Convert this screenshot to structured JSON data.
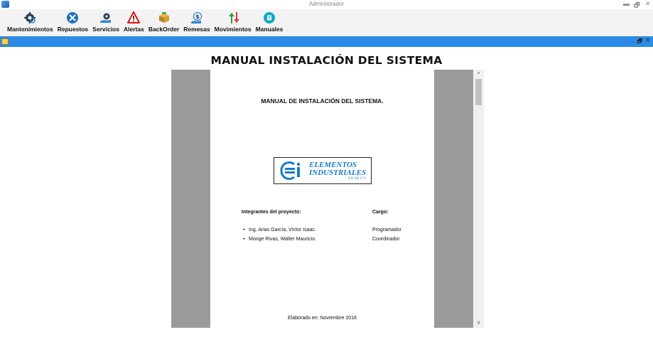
{
  "window": {
    "title": "Administrador",
    "controls": [
      "▬",
      "🗗",
      "✕"
    ]
  },
  "toolbar": {
    "items": [
      {
        "label": "Mantenimientos",
        "icon": "gear-search-icon"
      },
      {
        "label": "Repuestos",
        "icon": "wrench-icon"
      },
      {
        "label": "Servicios",
        "icon": "hand-gear-icon"
      },
      {
        "label": "Alertas",
        "icon": "warning-icon"
      },
      {
        "label": "BackOrder",
        "icon": "box-icon"
      },
      {
        "label": "Remesas",
        "icon": "money-hand-icon"
      },
      {
        "label": "Movimientos",
        "icon": "up-down-arrows-icon"
      },
      {
        "label": "Manuales",
        "icon": "book-icon"
      }
    ]
  },
  "child_window": {
    "controls": [
      "_",
      "🗗",
      "✕"
    ]
  },
  "main": {
    "heading": "MANUAL INSTALACIÓN DEL SISTEMA"
  },
  "document": {
    "title": "MANUAL DE INSTALACIÓN DEL SISTEMA.",
    "logo": {
      "line1": "ELEMENTOS",
      "line2": "INDUSTRIALES",
      "line3": "S.A. DE C.V."
    },
    "members_header": "Integrantes del proyecto:",
    "role_header": "Cargo:",
    "members": [
      {
        "name": "Ing. Arias García, Víctor Isaac.",
        "role": "Programador"
      },
      {
        "name": "Monge Rivas, Walter Mauricio.",
        "role": "Coordinador"
      }
    ],
    "footer": "Elaborado en: Noviembre 2018"
  },
  "scrollbar": {
    "up": "^",
    "down": "v"
  },
  "colors": {
    "mdi_bar": "#2b8be6",
    "viewer_bg": "#9b9b9b",
    "toolbar_bg": "#f3f3f3",
    "logo_blue": "#1a7cc4"
  }
}
